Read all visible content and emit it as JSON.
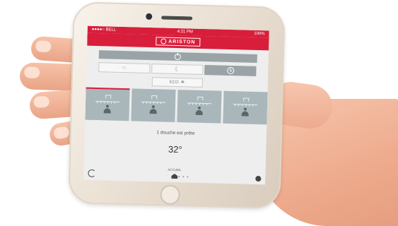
{
  "status_bar": {
    "carrier": "●●●●○ BELL",
    "time": "4:21 PM",
    "battery": "100%"
  },
  "header": {
    "brand": "ARISTON"
  },
  "modes": [
    {
      "icon": "hand-icon",
      "symbol": "☜",
      "active": false
    },
    {
      "icon": "moon-icon",
      "symbol": "☾",
      "active": false
    },
    {
      "icon": "clock-icon",
      "symbol": "",
      "active": true
    }
  ],
  "eco_label": "ECO",
  "eco_icon_symbol": "☘",
  "showers": [
    {
      "active": true
    },
    {
      "active": false
    },
    {
      "active": false
    },
    {
      "active": false
    }
  ],
  "ready_text": "1 douche est prête",
  "temperature": "32°",
  "nav": {
    "home_label": "ACCUEIL"
  },
  "colors": {
    "brand_red": "#d81e3b",
    "panel_grey": "#9aa4a7",
    "shower_tile": "#a9b7bb"
  }
}
